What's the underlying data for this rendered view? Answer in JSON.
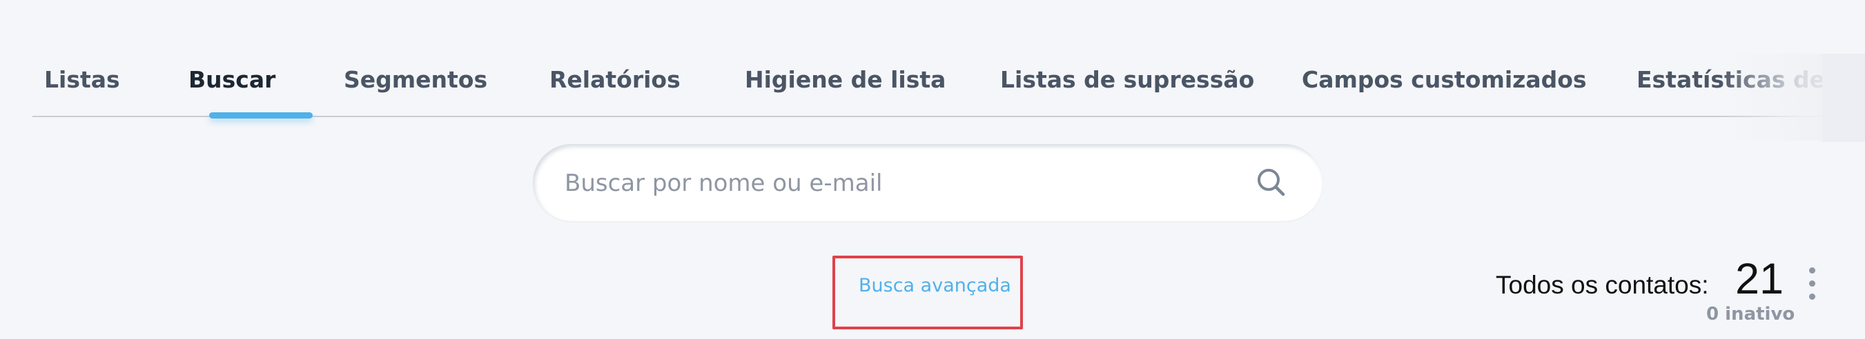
{
  "tabs": [
    {
      "label": "Listas"
    },
    {
      "label": "Buscar"
    },
    {
      "label": "Segmentos"
    },
    {
      "label": "Relatórios"
    },
    {
      "label": "Higiene de lista"
    },
    {
      "label": "Listas de supressão"
    },
    {
      "label": "Campos customizados"
    },
    {
      "label": "Estatísticas de i"
    }
  ],
  "active_tab": "Buscar",
  "search": {
    "placeholder": "Buscar por nome ou e-mail",
    "value": "",
    "icon": "search-icon"
  },
  "advanced_search": {
    "label": "Busca avançada"
  },
  "contacts": {
    "label": "Todos os contatos:",
    "count": "21",
    "inactive": "0 inativo"
  },
  "colors": {
    "accent": "#4fb1ea",
    "highlight_border": "#e0424a",
    "tab_text": "#4a5565",
    "background": "#f5f6f9"
  }
}
